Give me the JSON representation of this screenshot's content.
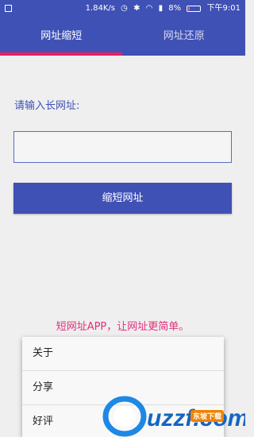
{
  "status_bar": {
    "speed": "1.84K/s",
    "battery": "8%",
    "time": "下午9:01",
    "icons": [
      "sim-icon",
      "alarm-icon",
      "bluetooth-icon",
      "wifi-icon",
      "signal-icon",
      "battery-icon"
    ]
  },
  "tabs": [
    {
      "label": "网址缩短",
      "active": true
    },
    {
      "label": "网址还原",
      "active": false
    }
  ],
  "form": {
    "label": "请输入长网址:",
    "input_value": "",
    "button_label": "缩短网址"
  },
  "slogan": "短网址APP，让网址更简单。",
  "menu": {
    "items": [
      "关于",
      "分享",
      "好评"
    ]
  },
  "watermark": {
    "logo_text": "uzzf.com",
    "badge_text": "东坡下载"
  },
  "colors": {
    "primary": "#3f51b5",
    "accent": "#e91e63",
    "slogan": "#e0307a"
  }
}
